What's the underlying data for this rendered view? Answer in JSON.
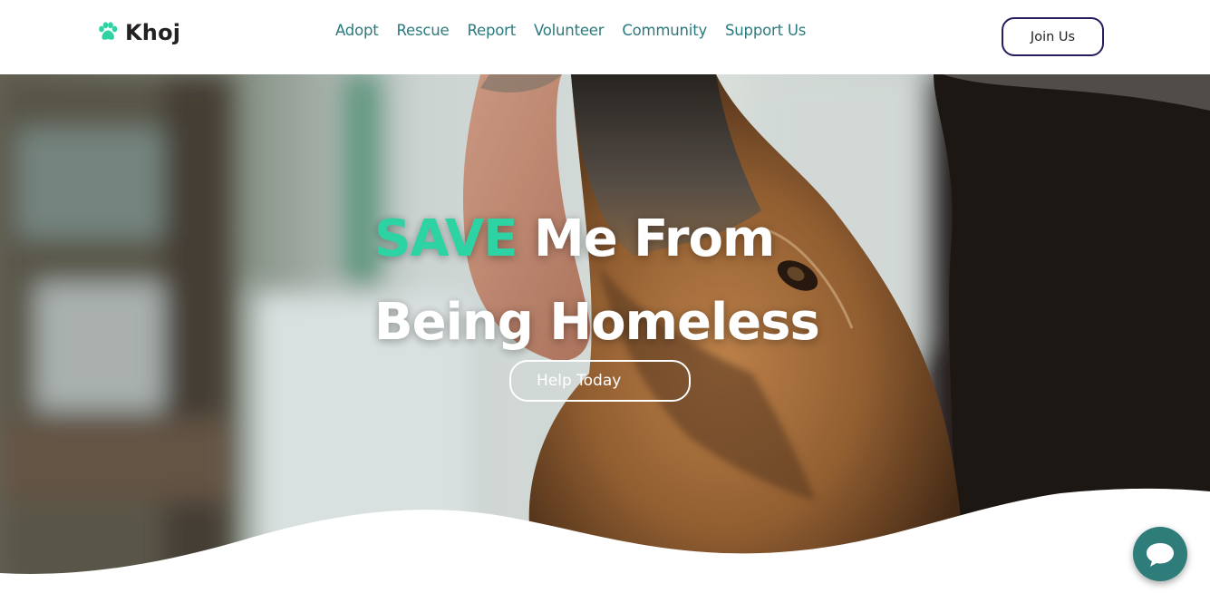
{
  "brand": {
    "name": "Khoj",
    "logo_icon": "paw-icon",
    "accent_color": "#2ed3a4"
  },
  "nav": {
    "items": [
      {
        "label": "Adopt"
      },
      {
        "label": "Rescue"
      },
      {
        "label": "Report"
      },
      {
        "label": "Volunteer"
      },
      {
        "label": "Community"
      },
      {
        "label": "Support Us"
      }
    ],
    "join_label": "Join Us"
  },
  "hero": {
    "headline_accent": "SAVE",
    "headline_line1_rest": " Me From",
    "headline_line2": "Being Homeless",
    "cta_label": "Help Today"
  },
  "chat": {
    "icon": "chat-bubble-icon",
    "color": "#2e7d7b"
  }
}
